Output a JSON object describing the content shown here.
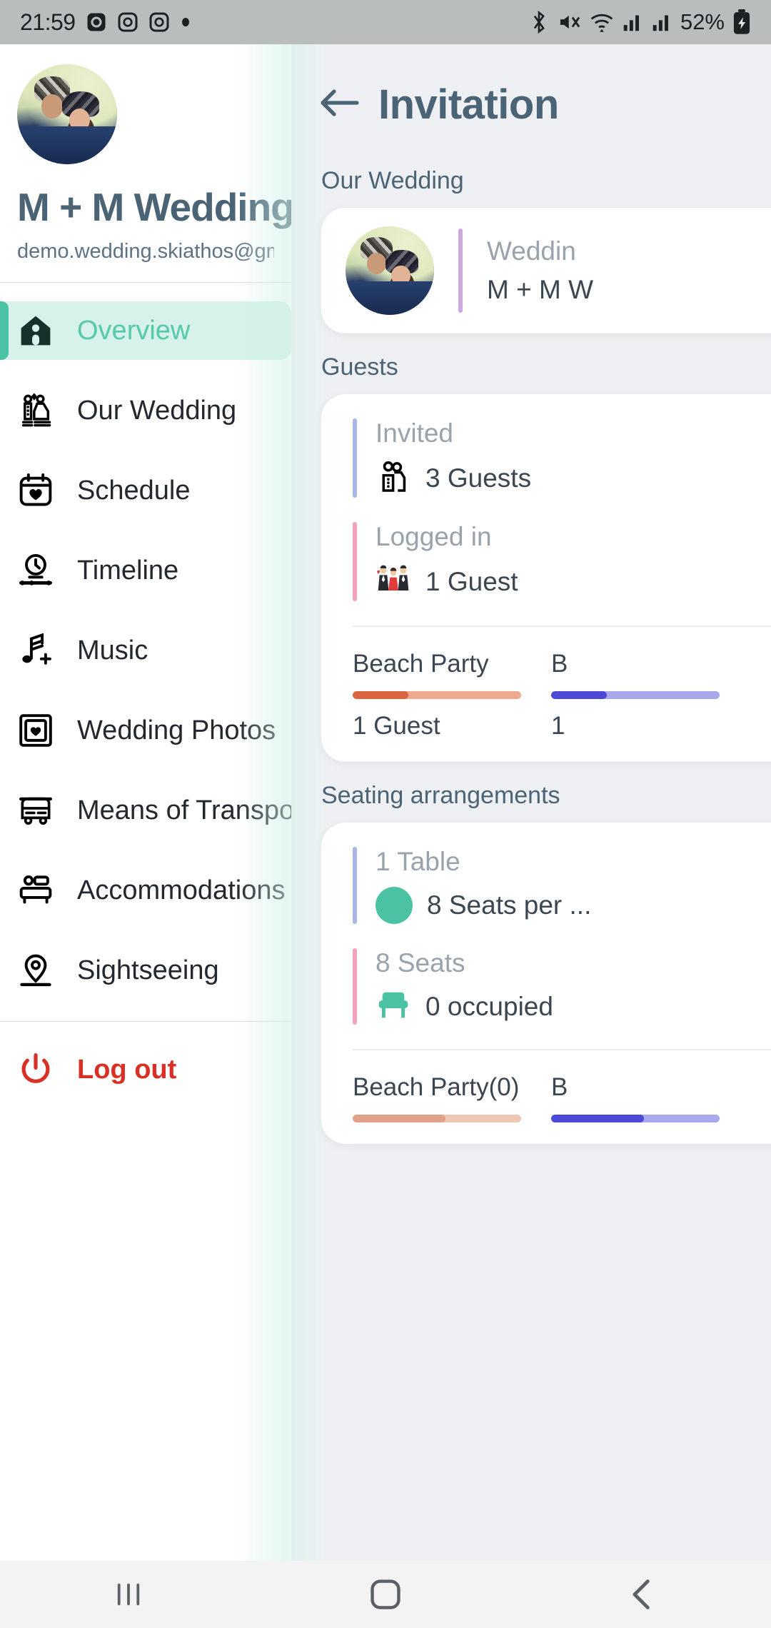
{
  "status_bar": {
    "time": "21:59",
    "left_icons": [
      "alarm-icon",
      "instagram-icon",
      "instagram-icon",
      "dot-icon"
    ],
    "right_icons": [
      "bluetooth-icon",
      "mute-icon",
      "wifi-icon",
      "signal-icon",
      "signal-icon"
    ],
    "battery": "52%"
  },
  "drawer": {
    "avatar": "couple-photo-avatar",
    "title": "M + M Wedding",
    "email": "demo.wedding.skiathos@gmail.co",
    "items": [
      {
        "label": "Overview",
        "icon": "home-icon",
        "active": true
      },
      {
        "label": "Our Wedding",
        "icon": "bride-groom-icon",
        "active": false
      },
      {
        "label": "Schedule",
        "icon": "calendar-heart-icon",
        "active": false
      },
      {
        "label": "Timeline",
        "icon": "clock-timeline-icon",
        "active": false
      },
      {
        "label": "Music",
        "icon": "music-note-icon",
        "active": false
      },
      {
        "label": "Wedding Photos",
        "icon": "photo-heart-icon",
        "active": false
      },
      {
        "label": "Means of Transport",
        "icon": "bus-icon",
        "active": false
      },
      {
        "label": "Accommodations",
        "icon": "bed-icon",
        "active": false
      },
      {
        "label": "Sightseeing",
        "icon": "map-pin-icon",
        "active": false
      }
    ],
    "logout": {
      "label": "Log out",
      "icon": "power-icon"
    }
  },
  "main": {
    "header": {
      "back_icon": "arrow-left-icon",
      "title": "Invitation"
    },
    "sections": [
      {
        "label": "Our Wedding",
        "card": {
          "avatar": "couple-photo-avatar",
          "accent_color": "#cda8e0",
          "caption": "Weddin",
          "name": "M + M W"
        }
      },
      {
        "label": "Guests",
        "stats": [
          {
            "caption": "Invited",
            "icon": "couple-outline-icon",
            "value": "3 Guests",
            "accent_color": "#a9b6e8"
          },
          {
            "caption": "Logged in",
            "icon": "wedding-party-emoji",
            "value": "1 Guest",
            "accent_color": "#f3a3ba"
          }
        ],
        "progress": [
          {
            "name": "Beach Party",
            "count": "1 Guest",
            "percent": 33,
            "fill_color": "#d9663e",
            "track_color": "#edaa91"
          },
          {
            "name": "B",
            "count": "1",
            "percent": 33,
            "fill_color": "#4b49d6",
            "track_color": "#a9a8ec"
          }
        ]
      },
      {
        "label": "Seating arrangements",
        "stats": [
          {
            "caption": "1 Table",
            "icon": "green-circle-icon",
            "value": "8 Seats per ...",
            "accent_color": "#a9b6e8"
          },
          {
            "caption": "8 Seats",
            "icon": "chair-icon",
            "value": "0 occupied",
            "accent_color": "#f3a3ba"
          }
        ],
        "progress": [
          {
            "name": "Beach Party(0)",
            "count": "",
            "percent": 55,
            "fill_color": "#e0a188",
            "track_color": "#eec7b5"
          },
          {
            "name": "B",
            "count": "",
            "percent": 55,
            "fill_color": "#4b49d6",
            "track_color": "#a9a8ec"
          }
        ]
      }
    ]
  },
  "system_nav": {
    "recents": "recents-icon",
    "home": "home-square-icon",
    "back": "back-chevron-icon"
  },
  "colors": {
    "accent_teal": "#4cc2a4",
    "active_bg": "#d6f2ea",
    "title_slate": "#4a6375",
    "danger_red": "#d93025",
    "panel_bg": "#eff0f4"
  }
}
